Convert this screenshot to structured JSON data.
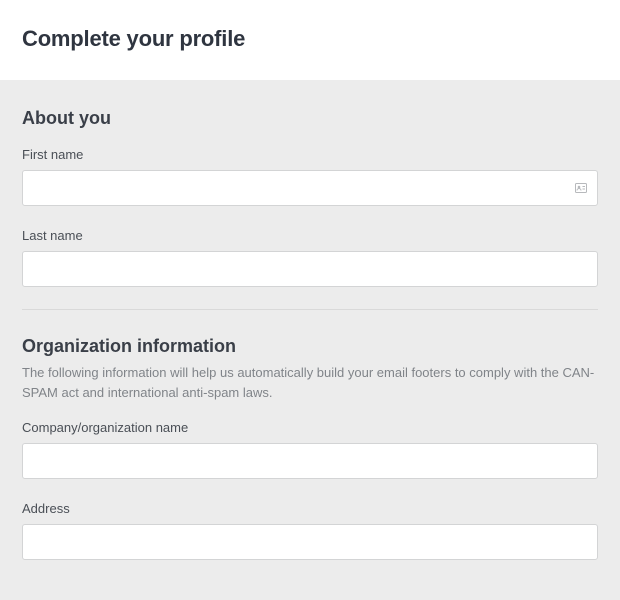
{
  "header": {
    "title": "Complete your profile"
  },
  "about": {
    "heading": "About you",
    "first_name_label": "First name",
    "first_name_value": "",
    "last_name_label": "Last name",
    "last_name_value": ""
  },
  "organization": {
    "heading": "Organization information",
    "description": "The following information will help us automatically build your email footers to comply with the CAN-SPAM act and international anti-spam laws.",
    "company_label": "Company/organization name",
    "company_value": "",
    "address_label": "Address",
    "address_value": ""
  }
}
